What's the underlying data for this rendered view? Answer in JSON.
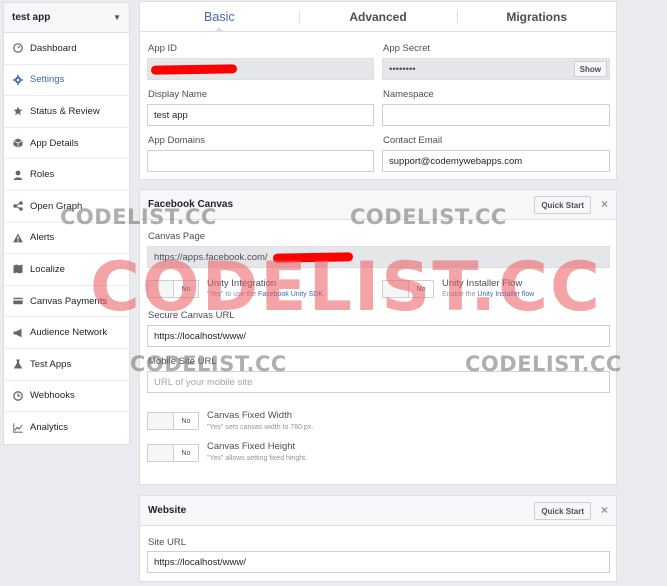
{
  "sidebar": {
    "app_selector": "test app",
    "items": [
      {
        "label": "Dashboard",
        "icon": "dashboard-icon"
      },
      {
        "label": "Settings",
        "icon": "gear-icon",
        "active": true
      },
      {
        "label": "Status & Review",
        "icon": "star-icon"
      },
      {
        "label": "App Details",
        "icon": "box-icon"
      },
      {
        "label": "Roles",
        "icon": "person-icon"
      },
      {
        "label": "Open Graph",
        "icon": "graph-icon"
      },
      {
        "label": "Alerts",
        "icon": "alert-icon"
      },
      {
        "label": "Localize",
        "icon": "map-icon"
      },
      {
        "label": "Canvas Payments",
        "icon": "card-icon"
      },
      {
        "label": "Audience Network",
        "icon": "megaphone-icon"
      },
      {
        "label": "Test Apps",
        "icon": "flask-icon"
      },
      {
        "label": "Webhooks",
        "icon": "webhook-icon"
      },
      {
        "label": "Analytics",
        "icon": "chart-icon"
      }
    ]
  },
  "tabs": [
    "Basic",
    "Advanced",
    "Migrations"
  ],
  "basic": {
    "app_id_label": "App ID",
    "app_secret_label": "App Secret",
    "app_secret_value": "••••••••",
    "show_button": "Show",
    "display_name_label": "Display Name",
    "display_name_value": "test app",
    "namespace_label": "Namespace",
    "namespace_value": "",
    "app_domains_label": "App Domains",
    "app_domains_value": "",
    "contact_email_label": "Contact Email",
    "contact_email_value": "support@codemywebapps.com"
  },
  "canvas": {
    "title": "Facebook Canvas",
    "quick_start": "Quick Start",
    "close": "×",
    "canvas_page_label": "Canvas Page",
    "canvas_page_value": "https://apps.facebook.com/",
    "unity_integration_title": "Unity Integration",
    "unity_integration_sub_pre": "\"Yes\" to use the ",
    "unity_integration_sub_link": "Facebook Unity SDK",
    "unity_installer_title": "Unity Installer Flow",
    "unity_installer_sub_pre": "Enable the ",
    "unity_installer_sub_link": "Unity Installer flow",
    "toggle_no": "No",
    "secure_url_label": "Secure Canvas URL",
    "secure_url_value": "https://localhost/www/",
    "mobile_url_label": "Mobile Site URL",
    "mobile_url_placeholder": "URL of your mobile site",
    "fixed_width_title": "Canvas Fixed Width",
    "fixed_width_sub": "\"Yes\" sets canvas width to 760 px.",
    "fixed_height_title": "Canvas Fixed Height",
    "fixed_height_sub": "\"Yes\" allows setting fixed height."
  },
  "website": {
    "title": "Website",
    "quick_start": "Quick Start",
    "close": "×",
    "site_url_label": "Site URL",
    "site_url_value": "https://localhost/www/"
  },
  "watermarks": {
    "text": "CODELIST.CC"
  },
  "colors": {
    "accent": "#4267b2",
    "redaction": "#ff0000"
  }
}
